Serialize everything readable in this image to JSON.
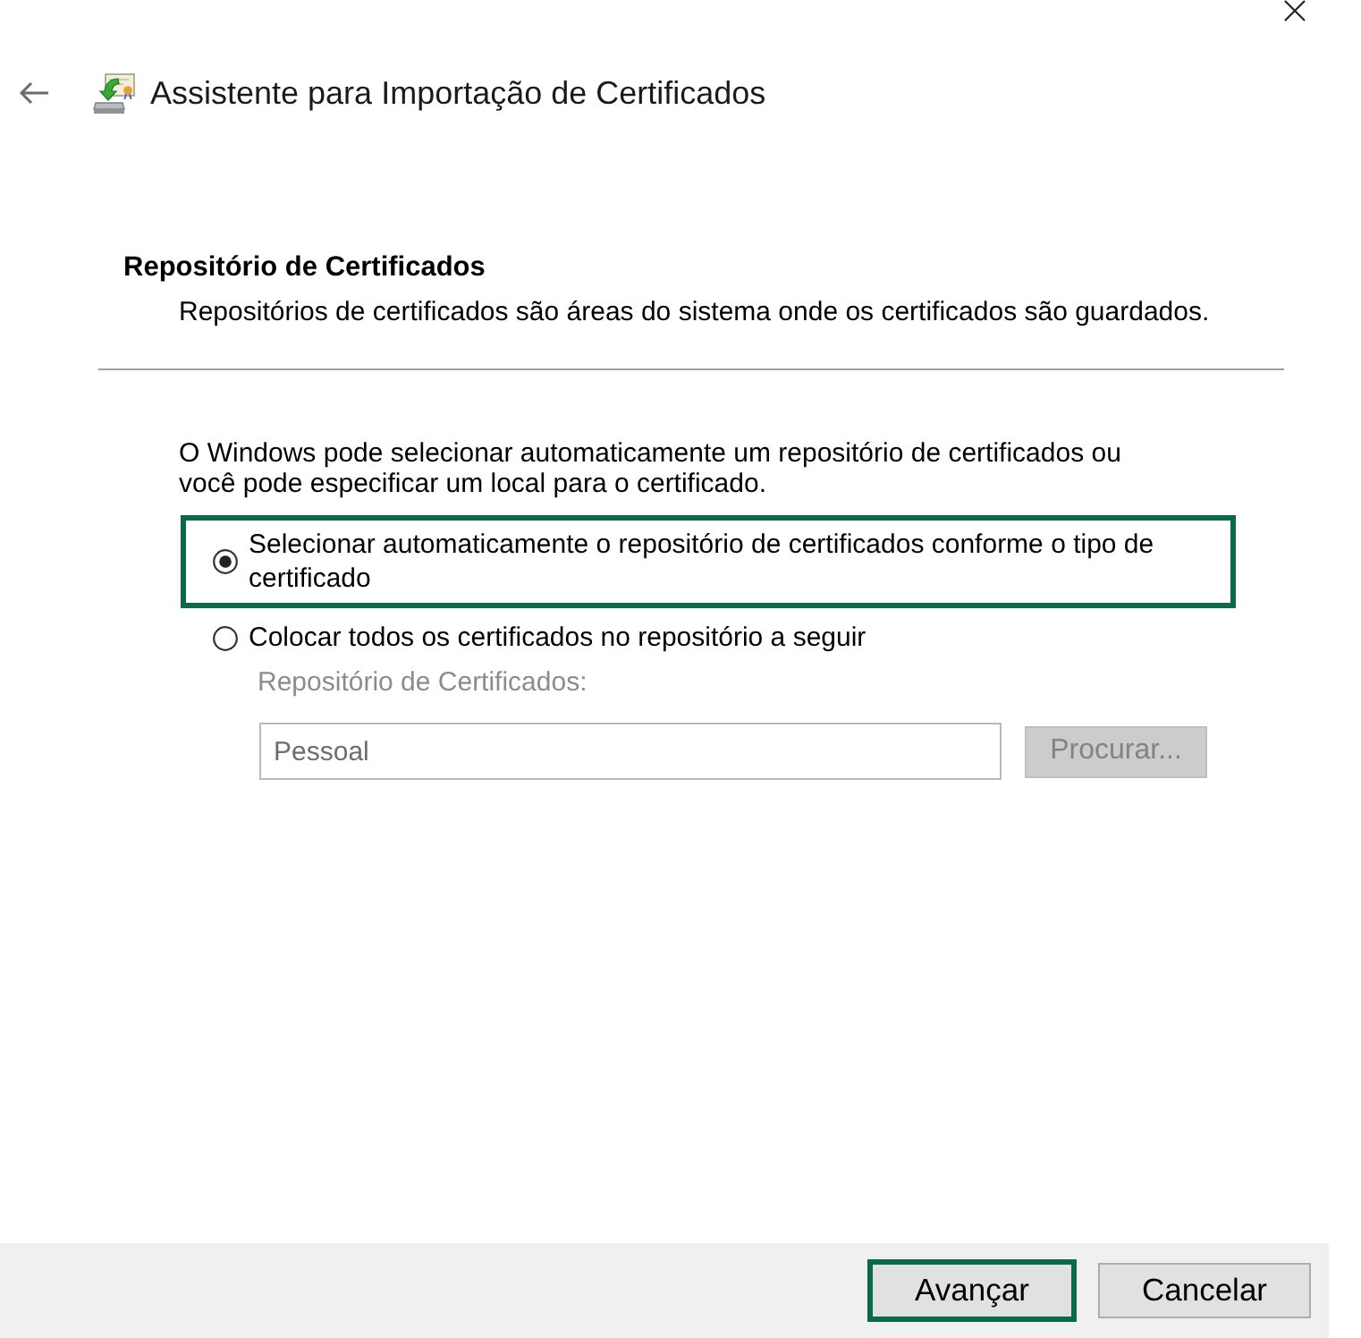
{
  "window": {
    "title": "Assistente para Importação de Certificados"
  },
  "page_header": {
    "title": "Repositório de Certificados",
    "subtitle": "Repositórios de certificados são áreas do sistema onde os certificados são guardados."
  },
  "intro": "O Windows pode selecionar automaticamente um repositório de certificados ou você pode especificar um local para o certificado.",
  "options": [
    {
      "label": "Selecionar automaticamente o repositório de certificados conforme o tipo de certificado",
      "selected": true,
      "highlighted": true
    },
    {
      "label": "Colocar todos os certificados no repositório a seguir",
      "selected": false,
      "highlighted": false
    }
  ],
  "store": {
    "label": "Repositório de Certificados:",
    "value": "Pessoal",
    "browse_button": "Procurar...",
    "disabled": true
  },
  "buttons": [
    {
      "label": "Avançar",
      "highlighted": true
    },
    {
      "label": "Cancelar",
      "highlighted": false
    }
  ]
}
